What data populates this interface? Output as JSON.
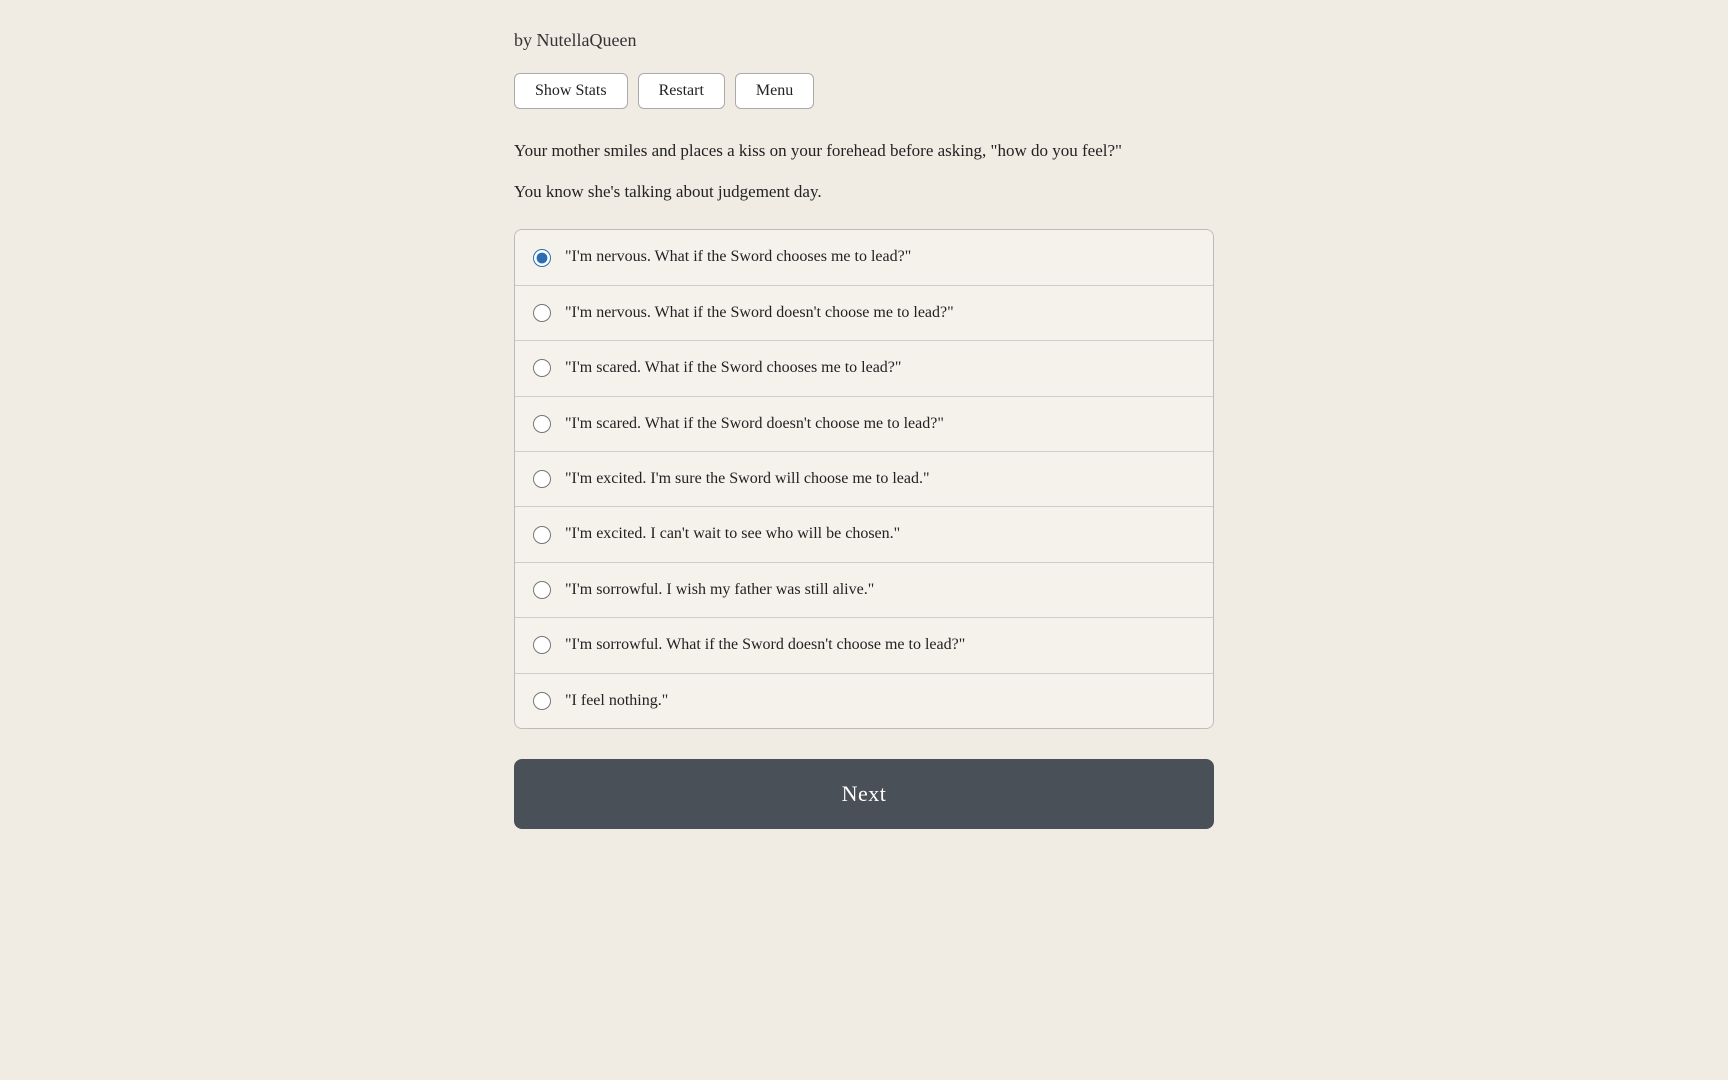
{
  "author": {
    "byline": "by NutellaQueen"
  },
  "toolbar": {
    "show_stats_label": "Show Stats",
    "restart_label": "Restart",
    "menu_label": "Menu"
  },
  "narrative": {
    "paragraph1": "Your mother smiles and places a kiss on your forehead before asking, \"how do you feel?\"",
    "paragraph2": "You know she's talking about judgement day."
  },
  "choices": [
    {
      "id": "choice1",
      "label": "\"I'm nervous. What if the Sword chooses me to lead?\"",
      "selected": true
    },
    {
      "id": "choice2",
      "label": "\"I'm nervous. What if the Sword doesn't choose me to lead?\"",
      "selected": false
    },
    {
      "id": "choice3",
      "label": "\"I'm scared. What if the Sword chooses me to lead?\"",
      "selected": false
    },
    {
      "id": "choice4",
      "label": "\"I'm scared. What if the Sword doesn't choose me to lead?\"",
      "selected": false
    },
    {
      "id": "choice5",
      "label": "\"I'm excited. I'm sure the Sword will choose me to lead.\"",
      "selected": false
    },
    {
      "id": "choice6",
      "label": "\"I'm excited. I can't wait to see who will be chosen.\"",
      "selected": false
    },
    {
      "id": "choice7",
      "label": "\"I'm sorrowful. I wish my father was still alive.\"",
      "selected": false
    },
    {
      "id": "choice8",
      "label": "\"I'm sorrowful. What if the Sword doesn't choose me to lead?\"",
      "selected": false
    },
    {
      "id": "choice9",
      "label": "\"I feel nothing.\"",
      "selected": false
    }
  ],
  "next_button": {
    "label": "Next"
  }
}
